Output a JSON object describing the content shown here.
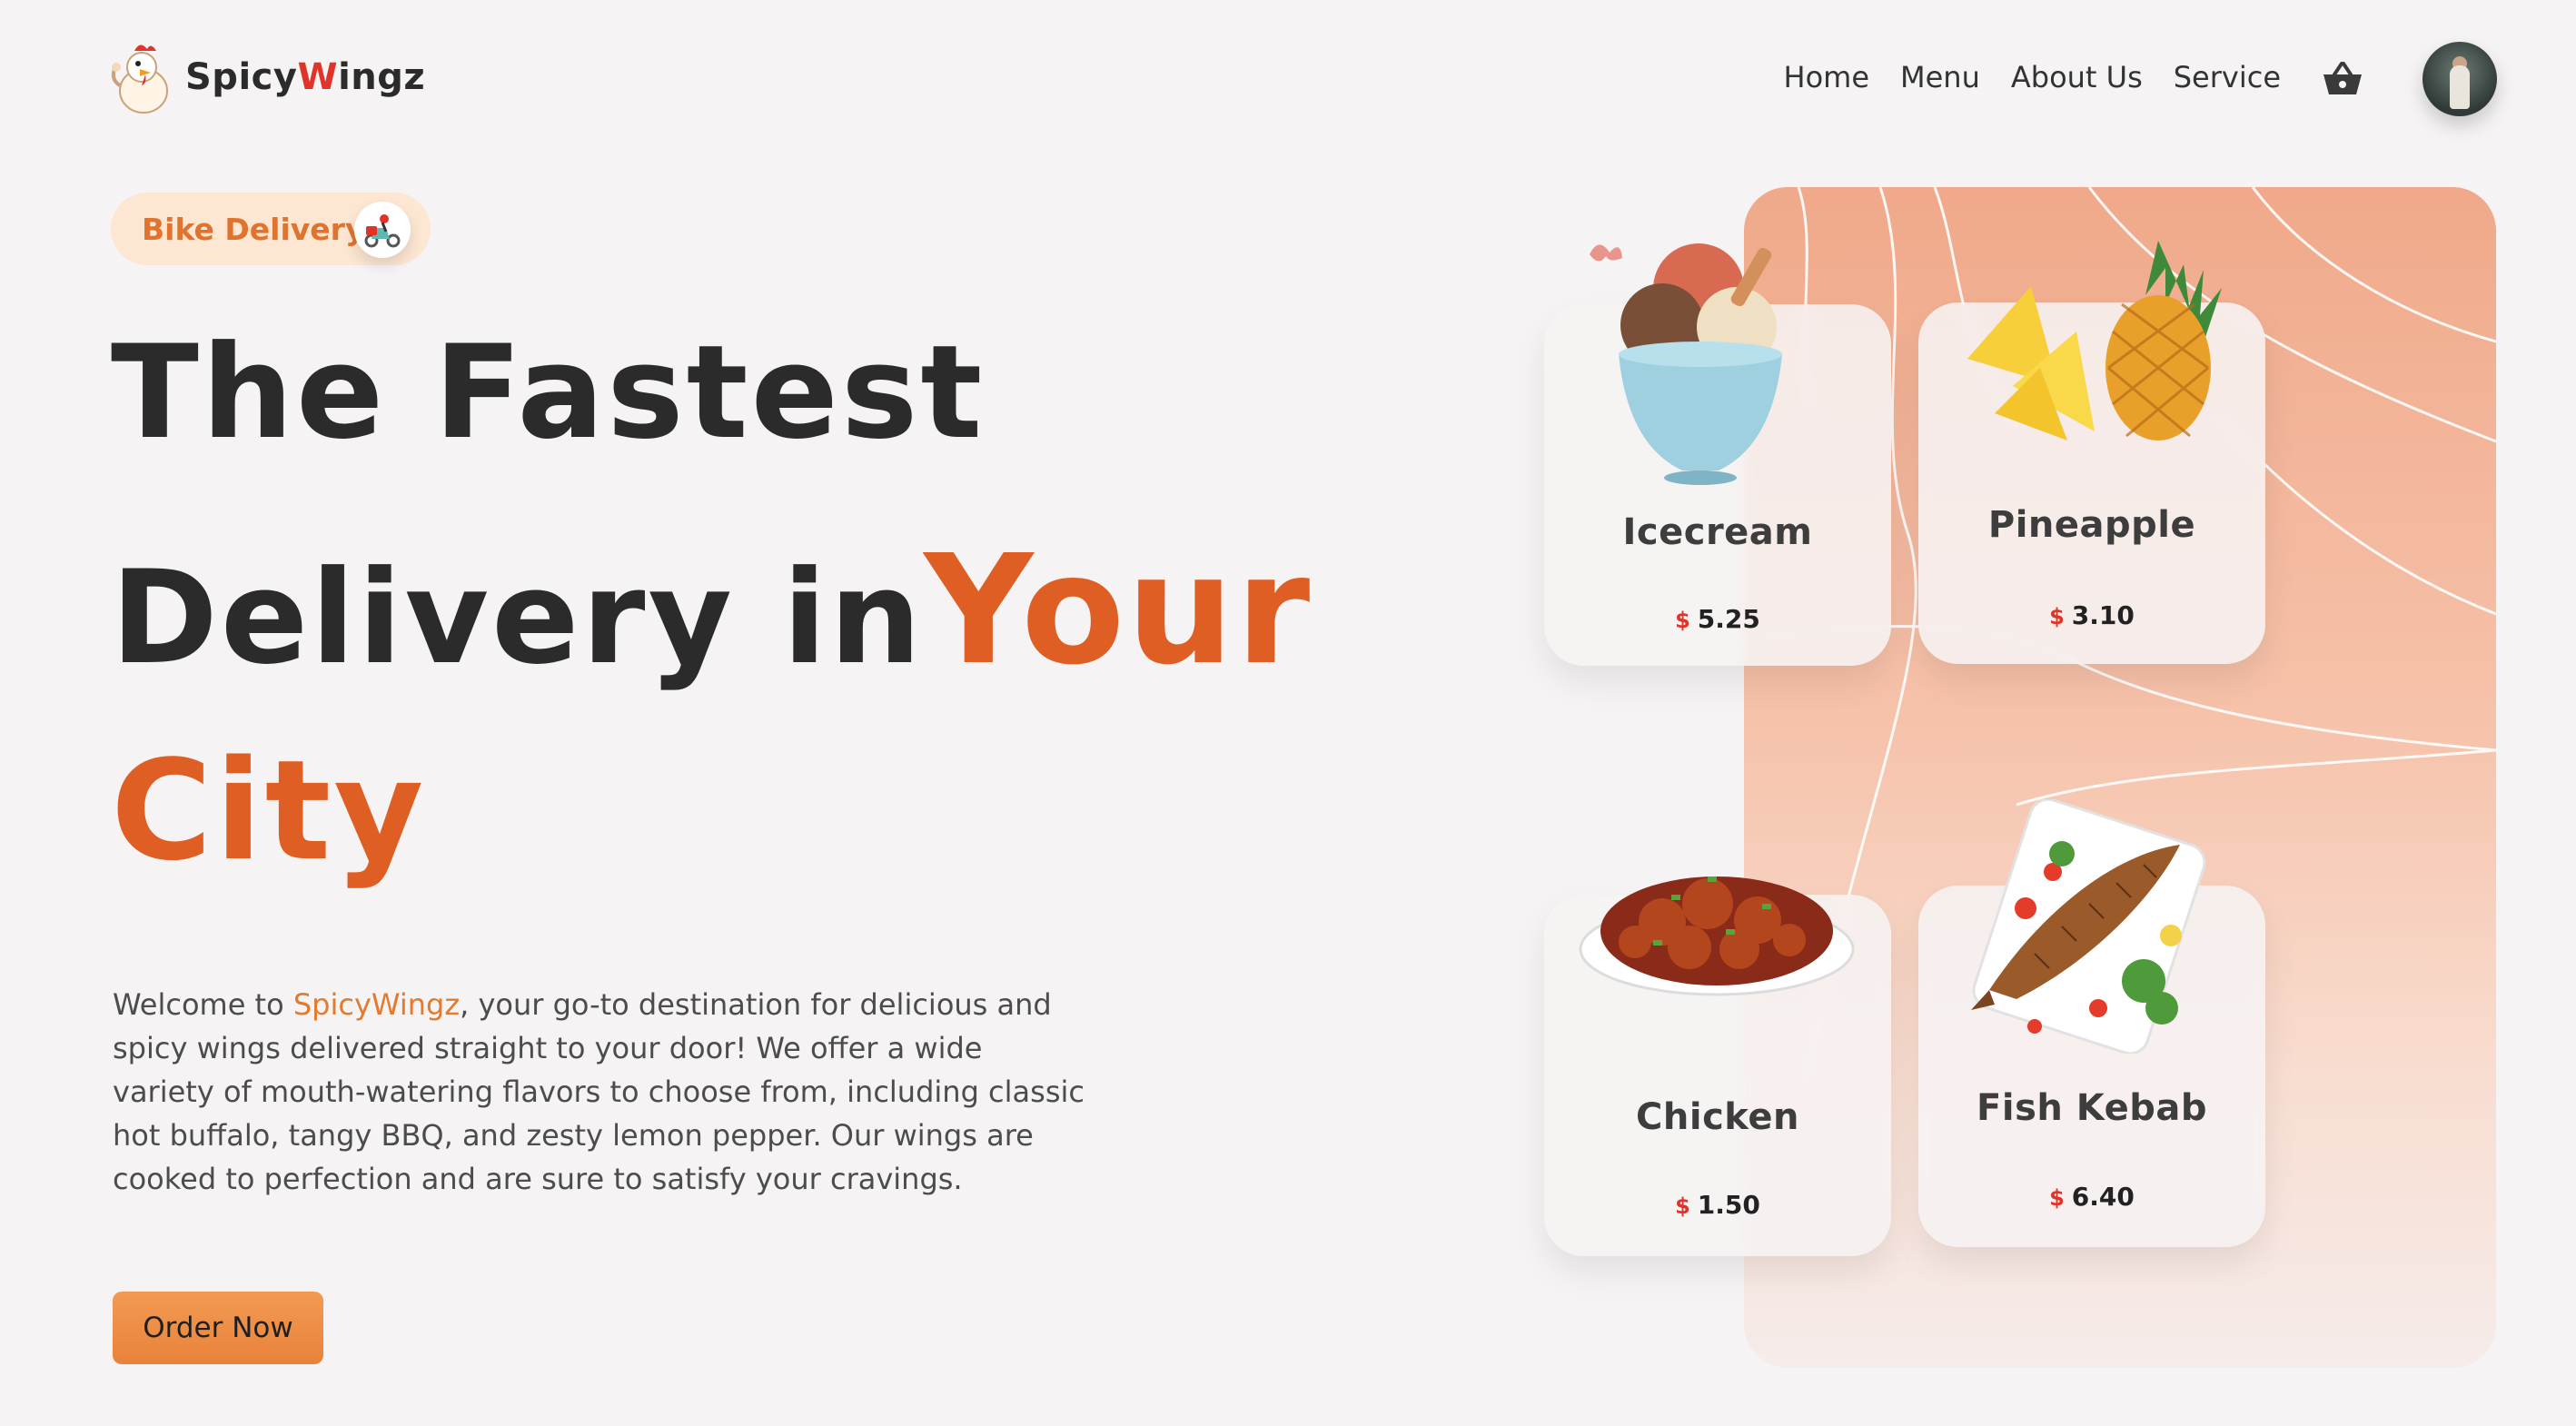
{
  "brand": {
    "part1": "Spicy",
    "part2": "W",
    "part3": "ingz"
  },
  "nav": {
    "items": [
      "Home",
      "Menu",
      "About Us",
      "Service"
    ]
  },
  "badge": {
    "label": "Bike Delivery"
  },
  "hero": {
    "line1": "The Fastest",
    "line2_plain": "Delivery in",
    "line2_highlight": "Your",
    "line3": "City"
  },
  "description": {
    "prefix": "Welcome to ",
    "brand": "SpicyWingz",
    "rest": ", your go-to destination for delicious and spicy wings delivered straight to your door! We offer a wide variety of mouth-watering flavors to choose from, including classic hot buffalo, tangy BBQ, and zesty lemon pepper. Our wings are cooked to perfection and are sure to satisfy your cravings."
  },
  "cta": {
    "label": "Order Now"
  },
  "currency": "$",
  "menu_cards": [
    {
      "name": "Icecream",
      "price": "5.25",
      "image": "icecream-bowl"
    },
    {
      "name": "Pineapple",
      "price": "3.10",
      "image": "pineapple"
    },
    {
      "name": "Chicken",
      "price": "1.50",
      "image": "chicken-bowl"
    },
    {
      "name": "Fish Kebab",
      "price": "6.40",
      "image": "fish-plate"
    }
  ],
  "colors": {
    "accent": "#df5e24",
    "brand_red": "#e0342a",
    "button": "#ec8b44",
    "panel_top": "#f0a98a"
  }
}
